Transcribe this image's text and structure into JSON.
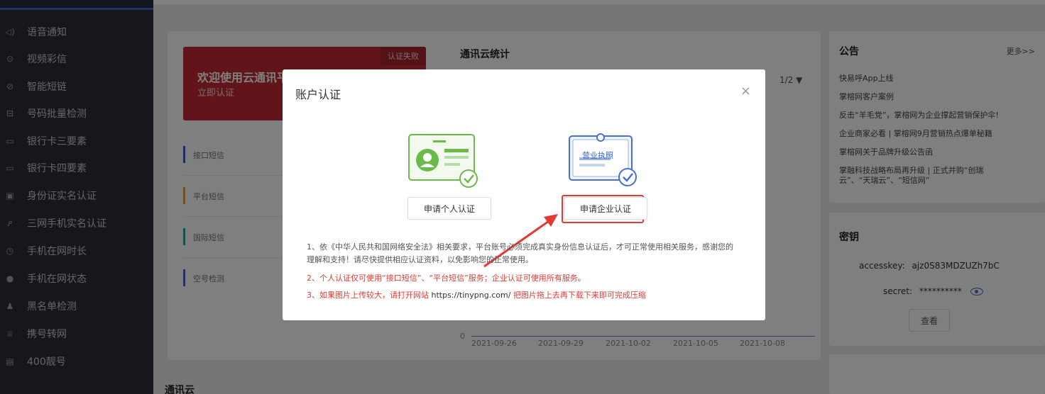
{
  "sidebar": {
    "items": [
      {
        "label": "语音通知",
        "icon": "speaker-icon"
      },
      {
        "label": "视频彩信",
        "icon": "play-circle-icon"
      },
      {
        "label": "智能短链",
        "icon": "compass-icon"
      },
      {
        "label": "号码批量检测",
        "icon": "scan-icon"
      },
      {
        "label": "银行卡三要素",
        "icon": "card-icon"
      },
      {
        "label": "银行卡四要素",
        "icon": "card-icon"
      },
      {
        "label": "身份证实名认证",
        "icon": "id-card-icon"
      },
      {
        "label": "三网手机实名认证",
        "icon": "users-icon"
      },
      {
        "label": "手机在网时长",
        "icon": "clock-icon"
      },
      {
        "label": "手机在网状态",
        "icon": "status-icon"
      },
      {
        "label": "黑名单检测",
        "icon": "user-block-icon"
      },
      {
        "label": "携号转网",
        "icon": "medal-icon"
      },
      {
        "label": "400靓号",
        "icon": "phone-icon"
      }
    ]
  },
  "promo": {
    "title": "欢迎使用云通讯平",
    "link": "立即认证",
    "badge": "认证失败"
  },
  "stats": {
    "title": "通讯云统计",
    "pager": "1/2 ▼",
    "services": [
      {
        "name": "接口短信",
        "color": "#3b5bcf"
      },
      {
        "name": "平台短信",
        "color": "#e6a23c"
      },
      {
        "name": "国际短信",
        "color": "#2aa99b"
      },
      {
        "name": "空号检测",
        "color": "#4a63c9"
      }
    ],
    "axis": {
      "zero": "0",
      "ticks": [
        "2021-09-26",
        "2021-09-29",
        "2021-10-02",
        "2021-10-05",
        "2021-10-08"
      ]
    }
  },
  "section_title": "通讯云",
  "announcements": {
    "title": "公告",
    "more": "更多>>",
    "items": [
      "快易呼App上线",
      "掌榕网客户案例",
      "反击“羊毛党”，掌榕网为企业撑起营销保护伞!",
      "企业商家必看 | 掌榕网9月营销热点爆单秘籍",
      "掌榕网关于品牌升级公告函",
      "掌融科技战略布局再升级 | 正式并购“创瑞云”、“天瑞云”、“短信网”"
    ]
  },
  "keys": {
    "title": "密钥",
    "accesskey_label": "accesskey:",
    "accesskey_value": "ajz0S83MDZUZh7bC",
    "secret_label": "secret:",
    "secret_value": "**********",
    "view_button": "查看"
  },
  "modal": {
    "title": "账户认证",
    "close": "×",
    "personal_button": "申请个人认证",
    "enterprise_button": "申请企业认证",
    "license_text": "营业执照",
    "note1": "1、依《中华人民共和国网络安全法》相关要求，平台账号必须完成真实身份信息认证后，才可正常使用相关服务，感谢您的理解和支持！请尽快提供相应认证资料，以免影响您的正常使用。",
    "note2": "2、个人认证仅可使用“接口短信”、“平台短信”服务；企业认证可使用所有服务。",
    "note3_a": "3、如果图片上传较大，请打开网站 ",
    "note3_url": "https://tinypng.com/",
    "note3_b": " 把图片拖上去再下载下来即可完成压缩"
  },
  "colors": {
    "sidebar_bg": "#2b2e3b",
    "promo_bg": "#c22b36",
    "highlight": "#e53935",
    "accent_blue": "#4b6fd6",
    "id_green": "#6abb4a"
  }
}
